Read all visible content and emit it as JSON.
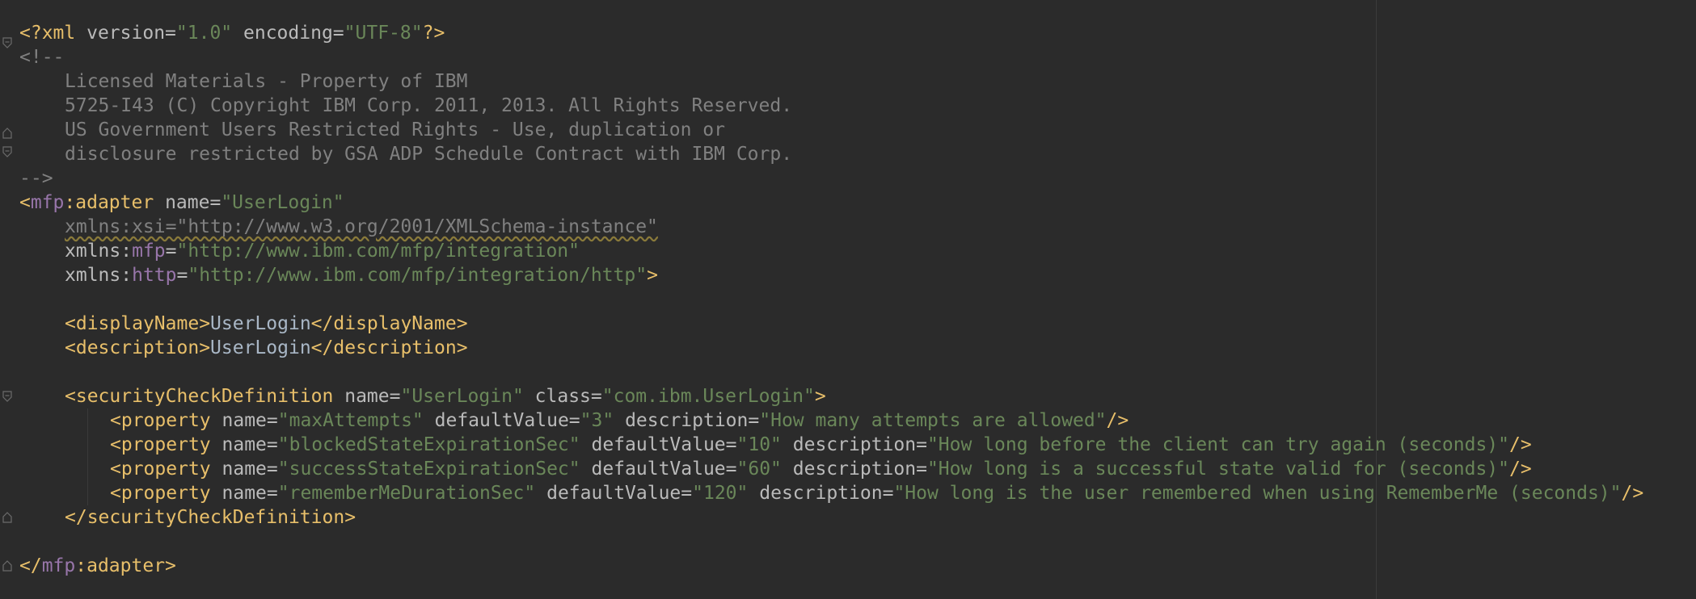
{
  "editor": {
    "language": "xml",
    "theme_colors": {
      "background": "#2b2b2b",
      "tag": "#e8bf6a",
      "namespace": "#9876aa",
      "attribute": "#bababa",
      "value": "#6a8759",
      "comment": "#808080",
      "text": "#a9b7c6"
    },
    "prolog": {
      "open": "<?xml",
      "version_attr": "version",
      "version_value": "\"1.0\"",
      "encoding_attr": "encoding",
      "encoding_value": "\"UTF-8\"",
      "close": "?>"
    },
    "comment": {
      "open": "<!--",
      "lines": [
        "Licensed Materials - Property of IBM",
        "5725-I43 (C) Copyright IBM Corp. 2011, 2013. All Rights Reserved.",
        "US Government Users Restricted Rights - Use, duplication or",
        "disclosure restricted by GSA ADP Schedule Contract with IBM Corp."
      ],
      "close": "-->"
    },
    "adapter": {
      "prefix": "mfp",
      "tag": "adapter",
      "name_attr": "name",
      "name_value": "\"UserLogin\"",
      "xmlns_xsi": "xmlns:xsi=\"http://www.w3.org/2001/XMLSchema-instance\"",
      "xmlns_attr": "xmlns:",
      "xmlns_mfp_prefix": "mfp",
      "xmlns_mfp_value": "\"http://www.ibm.com/mfp/integration\"",
      "xmlns_http_prefix": "http",
      "xmlns_http_value": "\"http://www.ibm.com/mfp/integration/http\""
    },
    "displayName": {
      "tag": "displayName",
      "value": "UserLogin"
    },
    "description": {
      "tag": "description",
      "value": "UserLogin"
    },
    "securityCheck": {
      "tag": "securityCheckDefinition",
      "name_attr": "name",
      "name_value": "\"UserLogin\"",
      "class_attr": "class",
      "class_value": "\"com.ibm.UserLogin\"",
      "properties": [
        {
          "name": "\"maxAttempts\"",
          "defaultValue": "\"3\"",
          "description": "\"How many attempts are allowed\""
        },
        {
          "name": "\"blockedStateExpirationSec\"",
          "defaultValue": "\"10\"",
          "description": "\"How long before the client can try again (seconds)\""
        },
        {
          "name": "\"successStateExpirationSec\"",
          "defaultValue": "\"60\"",
          "description": "\"How long is a successful state valid for (seconds)\""
        },
        {
          "name": "\"rememberMeDurationSec\"",
          "defaultValue": "\"120\"",
          "description": "\"How long is the user remembered when using RememberMe (seconds)\""
        }
      ]
    },
    "prop_tag": "property",
    "attr_name": "name",
    "attr_default": "defaultValue",
    "attr_description": "description"
  }
}
